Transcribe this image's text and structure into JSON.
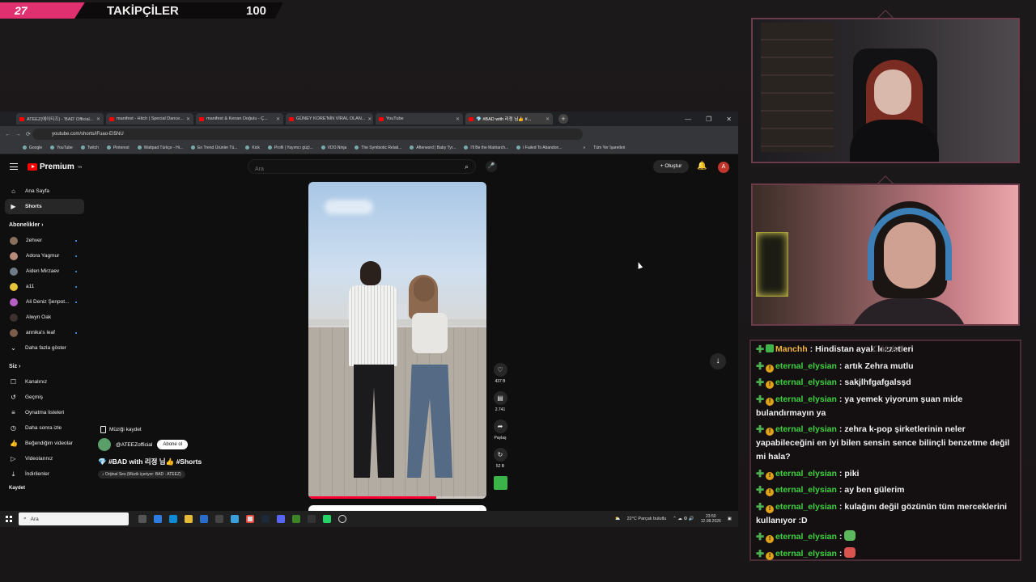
{
  "overlay": {
    "follower_count": "27",
    "follower_label": "TAKİPÇİLER",
    "follower_goal": "100"
  },
  "browser": {
    "tabs": [
      {
        "label": "ATEEZ(에이티즈) - 'BAD' Official..."
      },
      {
        "label": "manifest - Hitch | Special Dance..."
      },
      {
        "label": "manifest & Kenan Doğulu - Ç..."
      },
      {
        "label": "GÜNEY KORE'NİN VİRAL OLAN..."
      },
      {
        "label": "YouTube"
      },
      {
        "label": "💎 #BAD with 리정 님👍 #..."
      }
    ],
    "new_tab": "+",
    "url": "youtube.com/shorts/iFuao-EI5NU",
    "bookmarks": [
      "Google",
      "YouTube",
      "Twitch",
      "Pinterest",
      "Wattpad Türkçe - Hi...",
      "En Trend Ürünler Tü...",
      "Kick",
      "Profil | Yayımcı güçl...",
      "VDO.Ninja",
      "The Symbiotic Relati...",
      "Afterword | Baby Tyr...",
      "I'll Be the Matriarch...",
      "I Failed To Abandon..."
    ],
    "bookmarks_more": "»",
    "all_bookmarks": "Tüm Yer İşaretleri"
  },
  "youtube": {
    "logo_text": "Premium",
    "logo_tm": "TR",
    "search_placeholder": "Ara",
    "create_label": "+ Oluştur",
    "avatar_letter": "A",
    "sidebar": {
      "home": "Ana Sayfa",
      "shorts": "Shorts",
      "subs_header": "Abonelikler",
      "subscriptions": [
        "2ehver",
        "Adora Yagmur",
        "Aiden Mirzaev",
        "a11",
        "Ali Deniz Şenpot...",
        "Alwyn Oak",
        "annika's leaf"
      ],
      "show_more": "Daha fazla göster",
      "you_header": "Siz",
      "you_items": [
        "Kanalınız",
        "Geçmiş",
        "Oynatma listeleri",
        "Daha sonra izle",
        "Beğendiğim videolar",
        "Videolarınız",
        "İndirilenler"
      ],
      "cut_off": "Kaydet"
    },
    "short": {
      "save_music": "Müziği kaydet",
      "channel": "@ATEEZofficial",
      "subscribe": "Abone ol",
      "title": "💎 #BAD with 리정 님👍 #Shorts",
      "audio": "♪ Orijinal Ses (Müzik içeriyor: BAD · ATEEZ)",
      "likes": "437 B",
      "comments": "2.741",
      "share": "Paylaş",
      "remix": "52 B",
      "progress": 0.72
    }
  },
  "taskbar": {
    "search": "Ara",
    "weather": "22°C  Parçalı bulutlu",
    "time": "23:50",
    "date": "12.08.2026"
  },
  "chat": {
    "messages": [
      {
        "user": "Manchh",
        "text": "Hindistan ayak lezzetleri",
        "gold": true
      },
      {
        "user": "eternal_elysian",
        "text": "artık Zehra mutlu"
      },
      {
        "user": "eternal_elysian",
        "text": "sakjlhfgafgalsşd"
      },
      {
        "user": "eternal_elysian",
        "text": "ya yemek yiyorum şuan mide bulandırmayın ya"
      },
      {
        "user": "eternal_elysian",
        "text": "zehra k-pop şirketlerinin neler yapabileceğini en iyi bilen sensin sence bilinçli benzetme değil mi hala?"
      },
      {
        "user": "eternal_elysian",
        "text": "piki"
      },
      {
        "user": "eternal_elysian",
        "text": "ay ben gülerim"
      },
      {
        "user": "eternal_elysian",
        "text": "kulağını değil gözünün tüm merceklerini kullanıyor :D"
      },
      {
        "user": "eternal_elysian",
        "text": ""
      },
      {
        "user": "eternal_elysian",
        "text": ""
      }
    ],
    "separator": ":",
    "bg_text": "CHAT"
  }
}
